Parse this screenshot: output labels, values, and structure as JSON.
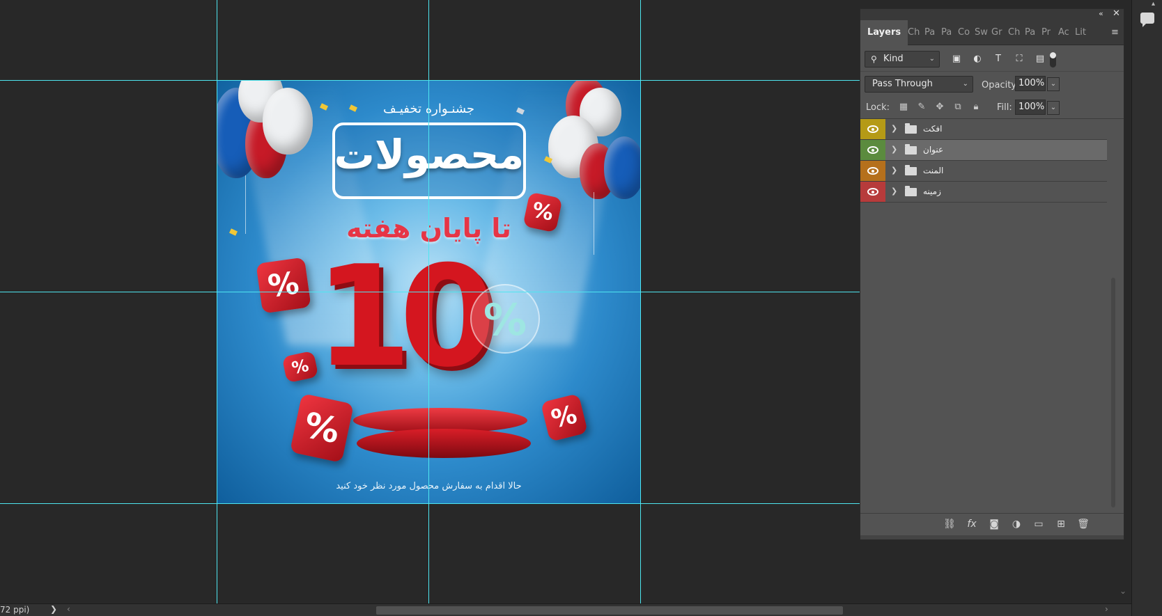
{
  "canvas": {
    "festival_title": "جشنـواره تخفیـف",
    "headline": "محصولات",
    "subheadline": "تا پایان هفته",
    "discount_number": "10",
    "percent_symbol": "%",
    "cta_text": "حالا اقدام به سفارش محصول مورد نظر خود کنید"
  },
  "status_bar": {
    "text": "72 ppi)",
    "arrow": "❯",
    "scroll_left": "‹",
    "scroll_right": "›"
  },
  "vscroll": {
    "down_arrow": "⌄"
  },
  "layers_panel": {
    "collapse": "«",
    "close": "✕",
    "tabs": [
      "Layers",
      "Ch",
      "Pa",
      "Pa",
      "Co",
      "Sw",
      "Gr",
      "Ch",
      "Pa",
      "Pr",
      "Ac",
      "Lit"
    ],
    "menu_icon": "≡",
    "filter": {
      "kind_label": "Kind",
      "search_icon": "⚲",
      "chevron": "⌄"
    },
    "filter_icons": [
      "image-filter-icon",
      "adjustment-filter-icon",
      "type-filter-icon",
      "shape-filter-icon",
      "smart-object-filter-icon"
    ],
    "blend_mode": "Pass Through",
    "opacity_label": "Opacity:",
    "opacity_value": "100%",
    "lock_label": "Lock:",
    "fill_label": "Fill:",
    "fill_value": "100%",
    "layers": [
      {
        "name": "افکت",
        "color": "#b59a16",
        "selected": false
      },
      {
        "name": "عنوان",
        "color": "#5b8b3e",
        "selected": true
      },
      {
        "name": "المنت",
        "color": "#b5701c",
        "selected": false
      },
      {
        "name": "زمینه",
        "color": "#b73b3b",
        "selected": false
      }
    ],
    "footer_icons": [
      "link-layers-icon",
      "fx-icon",
      "layer-mask-icon",
      "adjustment-layer-icon",
      "new-group-icon",
      "new-layer-icon",
      "delete-layer-icon"
    ]
  },
  "colors": {
    "workspace_bg": "#282828",
    "panel_bg": "#535353",
    "guide": "#4ee6f0",
    "accent_red": "#d4161f"
  }
}
